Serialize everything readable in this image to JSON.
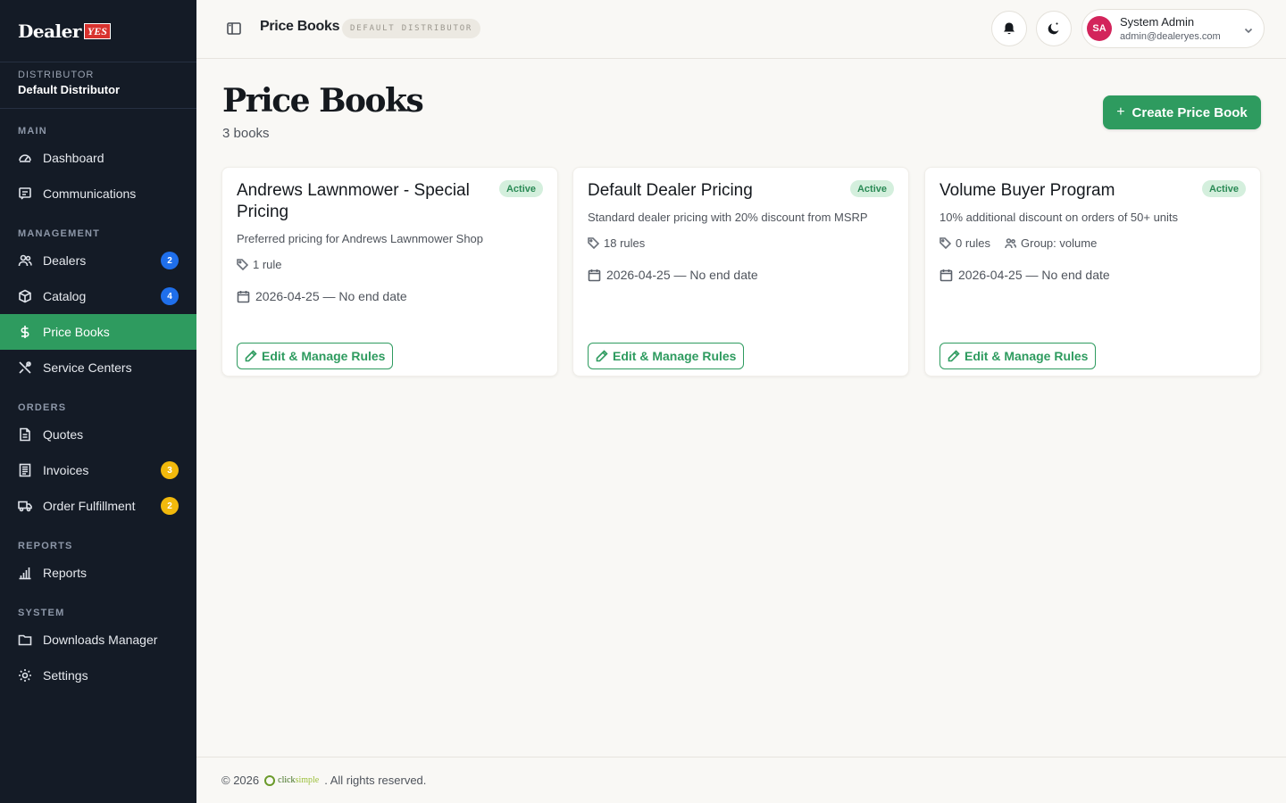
{
  "brand": {
    "name": "Dealer",
    "badge": "YES"
  },
  "distributor": {
    "label": "DISTRIBUTOR",
    "name": "Default Distributor"
  },
  "nav": {
    "sections": [
      {
        "label": "MAIN",
        "items": [
          {
            "label": "Dashboard",
            "icon": "gauge-icon"
          },
          {
            "label": "Communications",
            "icon": "message-icon"
          }
        ]
      },
      {
        "label": "MANAGEMENT",
        "items": [
          {
            "label": "Dealers",
            "icon": "users-icon",
            "badge": "2"
          },
          {
            "label": "Catalog",
            "icon": "box-icon",
            "badge": "4"
          },
          {
            "label": "Price Books",
            "icon": "dollar-icon",
            "active": true
          },
          {
            "label": "Service Centers",
            "icon": "tools-icon"
          }
        ]
      },
      {
        "label": "ORDERS",
        "items": [
          {
            "label": "Quotes",
            "icon": "document-icon"
          },
          {
            "label": "Invoices",
            "icon": "invoice-icon",
            "badge": "3"
          },
          {
            "label": "Order Fulfillment",
            "icon": "truck-icon",
            "badge": "2"
          }
        ]
      },
      {
        "label": "REPORTS",
        "items": [
          {
            "label": "Reports",
            "icon": "bar-chart-icon"
          }
        ]
      },
      {
        "label": "SYSTEM",
        "items": [
          {
            "label": "Downloads Manager",
            "icon": "folder-icon"
          },
          {
            "label": "Settings",
            "icon": "gear-icon"
          }
        ]
      }
    ]
  },
  "topbar": {
    "title": "Price Books",
    "chip": "DEFAULT DISTRIBUTOR",
    "user": {
      "initials": "SA",
      "name": "System Admin",
      "email": "admin@dealeryes.com"
    }
  },
  "page": {
    "title": "Price Books",
    "subtitle": "3 books",
    "create_label": "Create Price Book",
    "create_icon": "+"
  },
  "cards": [
    {
      "title": "Andrews Lawnmower - Special Pricing",
      "status": "Active",
      "description": "Preferred pricing for Andrews Lawnmower Shop",
      "rules": "1 rule",
      "group": "",
      "dates": "2026-04-25 — No end date",
      "edit_label": "Edit & Manage Rules"
    },
    {
      "title": "Default Dealer Pricing",
      "status": "Active",
      "description": "Standard dealer pricing with 20% discount from MSRP",
      "rules": "18 rules",
      "group": "",
      "dates": "2026-04-25 — No end date",
      "edit_label": "Edit & Manage Rules"
    },
    {
      "title": "Volume Buyer Program",
      "status": "Active",
      "description": "10% additional discount on orders of 50+ units",
      "rules": "0 rules",
      "group": "Group: volume",
      "dates": "2026-04-25 — No end date",
      "edit_label": "Edit & Manage Rules"
    }
  ],
  "footer": {
    "prefix": "© 2026",
    "logo_a": "click",
    "logo_b": "simple",
    "suffix": ". All rights reserved."
  },
  "colors": {
    "accent": "#2e9b5f",
    "sidebar": "#141b26",
    "badge_blue": "#1f6feb",
    "badge_yellow": "#f2b90c",
    "avatar": "#d3245b"
  }
}
